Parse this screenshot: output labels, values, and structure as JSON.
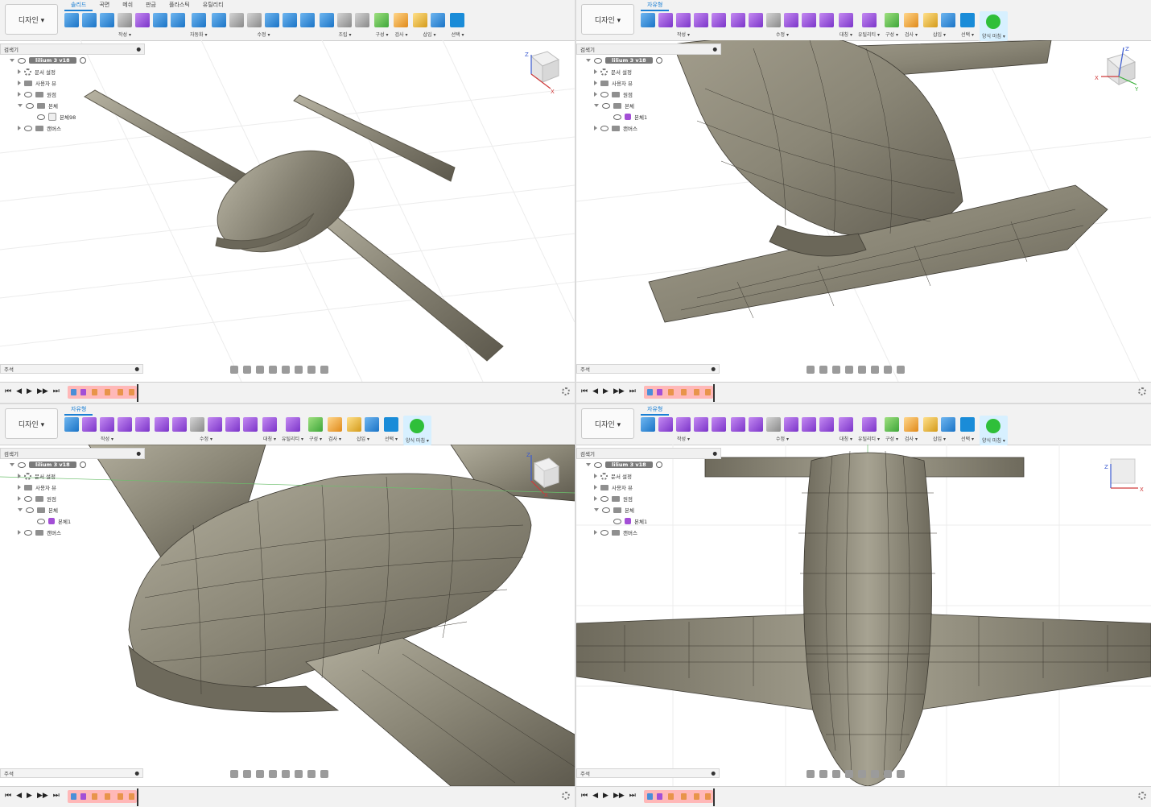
{
  "panes": [
    {
      "workspace": "디자인 ▾",
      "tabs": [
        "솔리드",
        "곡면",
        "메쉬",
        "판금",
        "플라스틱",
        "유틸리티"
      ],
      "active_tab": "솔리드",
      "groups": [
        "작성 ▾",
        "자동화 ▾",
        "수정 ▾",
        "조립 ▾",
        "구성 ▾",
        "검사 ▾",
        "삽입 ▾",
        "선택 ▾"
      ],
      "browser_title": "검색기",
      "root": "lilium 3 v18",
      "tree": [
        "문서 설정",
        "사용자 뷰",
        "원점",
        "본체",
        "본체98",
        "캔버스"
      ],
      "comments": "주석",
      "finish": ""
    },
    {
      "workspace": "디자인 ▾",
      "tabs": [
        "자유형"
      ],
      "active_tab": "자유형",
      "groups": [
        "작성 ▾",
        "수정 ▾",
        "대칭 ▾",
        "유틸리티 ▾",
        "구성 ▾",
        "검사 ▾",
        "삽입 ▾",
        "선택 ▾"
      ],
      "browser_title": "검색기",
      "root": "lilium 3 v18",
      "tree": [
        "문서 설정",
        "사용자 뷰",
        "원점",
        "본체",
        "본체1",
        "캔버스"
      ],
      "comments": "주석",
      "finish": "양식 마침 ▾"
    },
    {
      "workspace": "디자인 ▾",
      "tabs": [
        "자유형"
      ],
      "active_tab": "자유형",
      "groups": [
        "작성 ▾",
        "수정 ▾",
        "대칭 ▾",
        "유틸리티 ▾",
        "구성 ▾",
        "검사 ▾",
        "삽입 ▾",
        "선택 ▾"
      ],
      "browser_title": "검색기",
      "root": "lilium 3 v18",
      "tree": [
        "문서 설정",
        "사용자 뷰",
        "원점",
        "본체",
        "본체1",
        "캔버스"
      ],
      "comments": "주석",
      "finish": "양식 마침 ▾"
    },
    {
      "workspace": "디자인 ▾",
      "tabs": [
        "자유형"
      ],
      "active_tab": "자유형",
      "groups": [
        "작성 ▾",
        "수정 ▾",
        "대칭 ▾",
        "유틸리티 ▾",
        "구성 ▾",
        "검사 ▾",
        "삽입 ▾",
        "선택 ▾"
      ],
      "browser_title": "검색기",
      "root": "lilium 3 v18",
      "tree": [
        "문서 설정",
        "사용자 뷰",
        "원점",
        "본체",
        "본체1",
        "캔버스"
      ],
      "comments": "주석",
      "finish": "양식 마침 ▾"
    }
  ],
  "axes": {
    "x": "X",
    "y": "Y",
    "z": "Z"
  },
  "timeline_controls": [
    "⏮",
    "◀",
    "▶",
    "▶▶",
    "⏭"
  ],
  "colors": {
    "accent": "#1a7fd4",
    "model": "#8a8676",
    "model_dark": "#5f5b4f",
    "model_light": "#c8c4b5",
    "background": "#ffffff",
    "grid": "#e6e6e6"
  }
}
